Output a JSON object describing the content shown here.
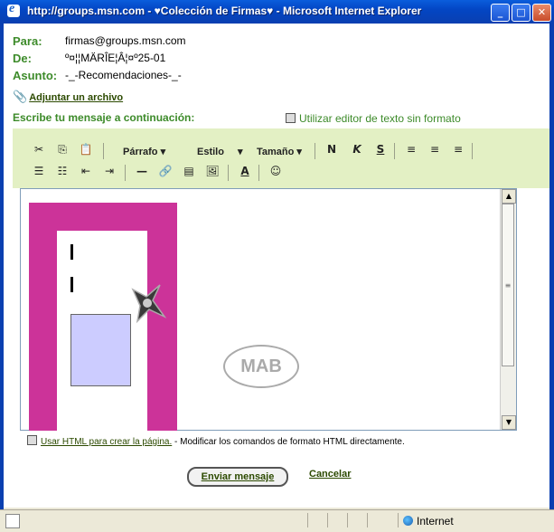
{
  "window": {
    "title": "http://groups.msn.com - ♥Colección de Firmas♥ - Microsoft Internet Explorer",
    "buttons": {
      "minimize": "_",
      "maximize": "□",
      "close": "✕"
    }
  },
  "form": {
    "to_label": "Para:",
    "to_value": "firmas@groups.msn.com",
    "from_label": "De:",
    "from_value": "º¤¦¦MÄRÎE¦Â¦¤º25-01",
    "subject_label": "Asunto:",
    "subject_value": "-_-Recomendaciones-_-",
    "attach_label": "Adjuntar un archivo",
    "write_label": "Escribe tu mensaje a continuación:",
    "plain_editor_label": "Utilizar editor de texto sin formato"
  },
  "toolbar": {
    "paragraph": "Párrafo",
    "style": "Estilo",
    "size": "Tamaño",
    "bold": "N",
    "italic": "K",
    "underline": "S"
  },
  "editor": {
    "watermark": "MAB"
  },
  "footer": {
    "html_link": "Usar HTML para crear la página.",
    "html_desc": " - Modificar los comandos de formato HTML directamente.",
    "send": "Enviar mensaje",
    "cancel": "Cancelar"
  },
  "status": {
    "zone": "Internet"
  },
  "icons": [
    "ie-icon",
    "cut-icon",
    "copy-icon",
    "paste-icon",
    "numbered-list-icon",
    "bullet-list-icon",
    "outdent-icon",
    "indent-icon",
    "hr-icon",
    "link-icon",
    "table-icon",
    "image-icon",
    "font-color-icon",
    "emoticon-icon",
    "paperclip-icon",
    "globe-icon"
  ]
}
